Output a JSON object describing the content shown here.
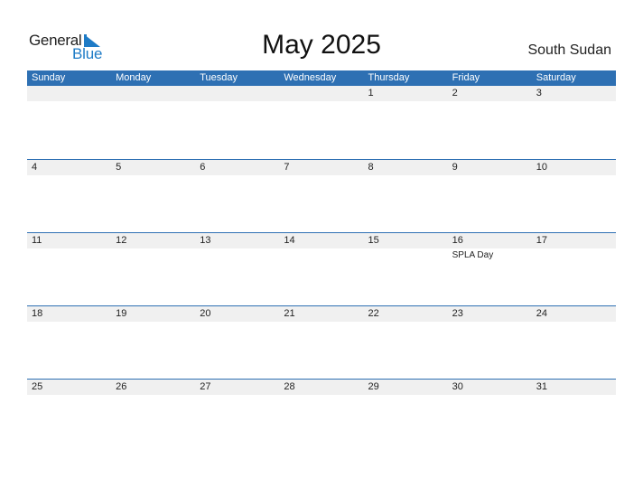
{
  "logo": {
    "word1": "General",
    "word2": "Blue"
  },
  "title": "May 2025",
  "country": "South Sudan",
  "colors": {
    "accent": "#2e70b3",
    "date_strip": "#f0f0f0",
    "logo_blue": "#1e7bc6"
  },
  "weekdays": [
    "Sunday",
    "Monday",
    "Tuesday",
    "Wednesday",
    "Thursday",
    "Friday",
    "Saturday"
  ],
  "weeks": [
    {
      "days": [
        "",
        "",
        "",
        "",
        "1",
        "2",
        "3"
      ],
      "events": [
        "",
        "",
        "",
        "",
        "",
        "",
        ""
      ]
    },
    {
      "days": [
        "4",
        "5",
        "6",
        "7",
        "8",
        "9",
        "10"
      ],
      "events": [
        "",
        "",
        "",
        "",
        "",
        "",
        ""
      ]
    },
    {
      "days": [
        "11",
        "12",
        "13",
        "14",
        "15",
        "16",
        "17"
      ],
      "events": [
        "",
        "",
        "",
        "",
        "",
        "SPLA Day",
        ""
      ]
    },
    {
      "days": [
        "18",
        "19",
        "20",
        "21",
        "22",
        "23",
        "24"
      ],
      "events": [
        "",
        "",
        "",
        "",
        "",
        "",
        ""
      ]
    },
    {
      "days": [
        "25",
        "26",
        "27",
        "28",
        "29",
        "30",
        "31"
      ],
      "events": [
        "",
        "",
        "",
        "",
        "",
        "",
        ""
      ]
    }
  ]
}
